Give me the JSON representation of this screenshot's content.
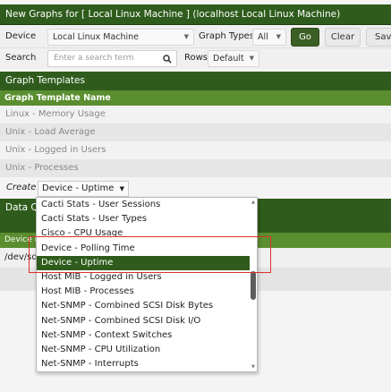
{
  "title": "New Graphs for [ Local Linux Machine ] (localhost Local Linux Machine)",
  "filters": {
    "device_label": "Device",
    "device_value": "Local Linux Machine",
    "graph_types_label": "Graph Types",
    "graph_types_value": "All",
    "go_label": "Go",
    "clear_label": "Clear",
    "save_label": "Save",
    "search_label": "Search",
    "search_placeholder": "Enter a search term",
    "rows_label": "Rows",
    "rows_value": "Default"
  },
  "graph_templates": {
    "header": "Graph Templates",
    "column_header": "Graph Template Name",
    "rows": [
      "Linux - Memory Usage",
      "Unix - Load Average",
      "Unix - Logged in Users",
      "Unix - Processes"
    ]
  },
  "create": {
    "label": "Create",
    "selected": "Device - Uptime"
  },
  "data_query": {
    "header": "Data Q",
    "column_header": "Device N",
    "row_value": "/dev/sd"
  },
  "dropdown": {
    "options": [
      "Cacti Stats - User Sessions",
      "Cacti Stats - User Types",
      "Cisco - CPU Usage",
      "Device - Polling Time",
      "Device - Uptime",
      "Host MIB - Logged in Users",
      "Host MIB - Processes",
      "Net-SNMP - Combined SCSI Disk Bytes",
      "Net-SNMP - Combined SCSI Disk I/O",
      "Net-SNMP - Context Switches",
      "Net-SNMP - CPU Utilization",
      "Net-SNMP - Interrupts"
    ],
    "selected_index": 4
  },
  "colors": {
    "header_green": "#2f5c1c",
    "column_green": "#5a8e2f",
    "highlight_red": "#d9302c"
  }
}
